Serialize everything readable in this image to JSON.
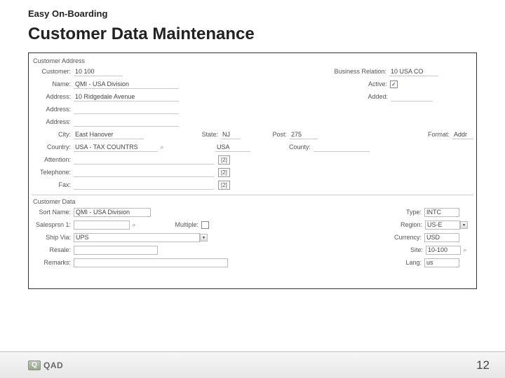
{
  "header": {
    "subtitle": "Easy On-Boarding",
    "title": "Customer Data Maintenance"
  },
  "panel": {
    "group_address": "Customer Address",
    "customer_lbl": "Customer:",
    "customer_val": "10 100",
    "brel_lbl": "Business Relation:",
    "brel_val": "10 USA CO",
    "name_lbl": "Name:",
    "name_val": "QMI - USA Division",
    "active_lbl": "Active:",
    "active_chk": "✓",
    "address1_lbl": "Address:",
    "address1_val": "10 Ridgedale Avenue",
    "added_lbl": "Added:",
    "added_val": "",
    "address2_lbl": "Address:",
    "address3_lbl": "Address:",
    "city_lbl": "City:",
    "city_val": "East Hanover",
    "state_lbl": "State:",
    "state_val": "NJ",
    "post_lbl": "Post:",
    "post_val": "275",
    "format_lbl": "Format:",
    "format_val": "Addr",
    "country_lbl": "Country:",
    "country_code": "USA - TAX COUNTRS",
    "country_name": "USA",
    "county_lbl": "County:",
    "attention_lbl": "Attention:",
    "ext1": "[2]",
    "telephone_lbl": "Telephone:",
    "ext2": "[2]",
    "fax_lbl": "Fax:",
    "ext3": "[2]",
    "group_data": "Customer Data",
    "sortname_lbl": "Sort Name:",
    "sortname_val": "QMI - USA Division",
    "type_lbl": "Type:",
    "type_val": "INTC",
    "salesprsn_lbl": "Salesprsn 1:",
    "multiple_lbl": "Multiple:",
    "region_lbl": "Region:",
    "region_val": "US-E",
    "shipvia_lbl": "Ship Via:",
    "shipvia_val": "UPS",
    "currency_lbl": "Currency:",
    "currency_val": "USD",
    "resale_lbl": "Resale:",
    "site_lbl": "Site:",
    "site_val": "10-100",
    "remarks_lbl": "Remarks:",
    "lang_lbl": "Lang:",
    "lang_val": "us"
  },
  "footer": {
    "logo_glyph": "Q",
    "logo_text": "QAD",
    "page": "12"
  }
}
